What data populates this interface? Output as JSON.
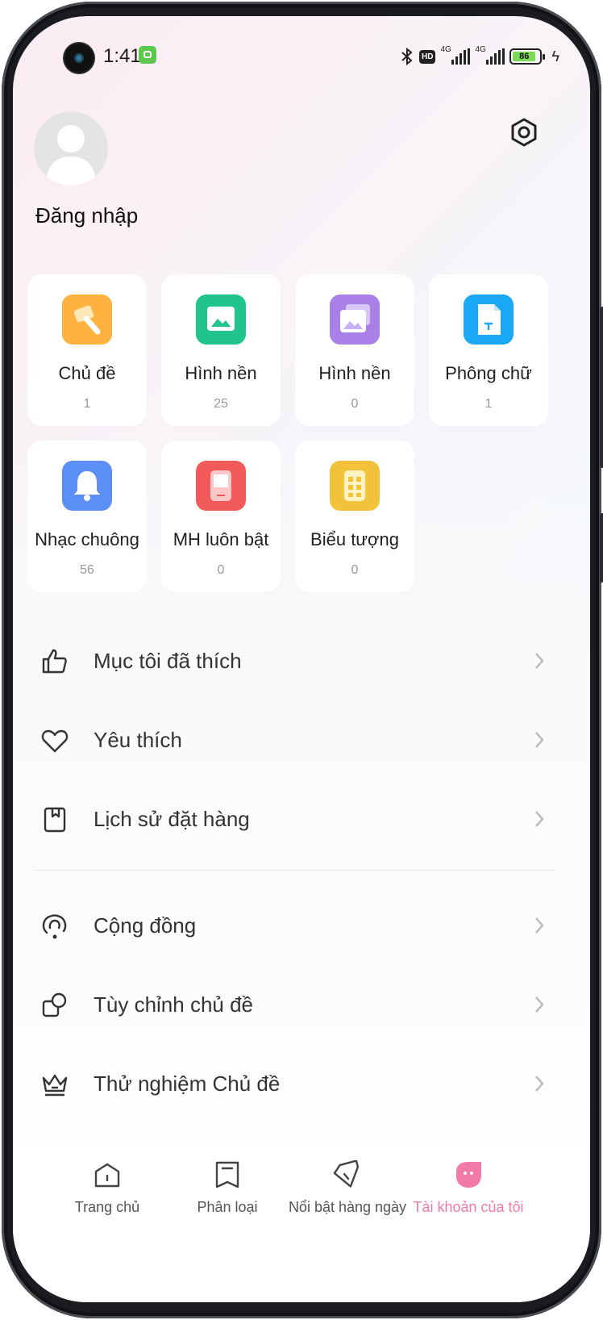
{
  "status_bar": {
    "time": "1:41",
    "battery": "86",
    "signal1_label": "4G",
    "signal2_label": "4G",
    "hd_label": "HD"
  },
  "profile": {
    "login_label": "Đăng nhập"
  },
  "categories": [
    {
      "name": "Chủ đề",
      "count": "1",
      "color": "#ffb23f",
      "icon": "brush-icon"
    },
    {
      "name": "Hình nền",
      "count": "25",
      "color": "#21c48a",
      "icon": "image-icon"
    },
    {
      "name": "Hình nền",
      "count": "0",
      "color": "#a97fe8",
      "icon": "live-wallpaper-icon"
    },
    {
      "name": "Phông chữ",
      "count": "1",
      "color": "#1aa7f5",
      "icon": "font-icon"
    },
    {
      "name": "Nhạc chuông",
      "count": "56",
      "color": "#5b8ff5",
      "icon": "bell-icon"
    },
    {
      "name": "MH luôn bật",
      "count": "0",
      "color": "#f25a5a",
      "icon": "always-on-display-icon"
    },
    {
      "name": "Biểu tượng",
      "count": "0",
      "color": "#f2c23a",
      "icon": "app-icons-icon"
    }
  ],
  "menu": {
    "liked": "Mục tôi đã thích",
    "favorites": "Yêu thích",
    "order_history": "Lịch sử đặt hàng",
    "community": "Cộng đồng",
    "customize_theme": "Tùy chỉnh chủ đề",
    "beta_theme": "Thử nghiệm Chủ đề"
  },
  "bottom_nav": [
    {
      "label": "Trang chủ",
      "icon": "home-icon"
    },
    {
      "label": "Phân loại",
      "icon": "category-icon"
    },
    {
      "label": "Nổi bật hàng ngày",
      "icon": "diamond-icon"
    },
    {
      "label": "Tài khoản của tôi",
      "icon": "account-icon",
      "active": true
    }
  ],
  "colors": {
    "accent": "#f27aa6"
  }
}
